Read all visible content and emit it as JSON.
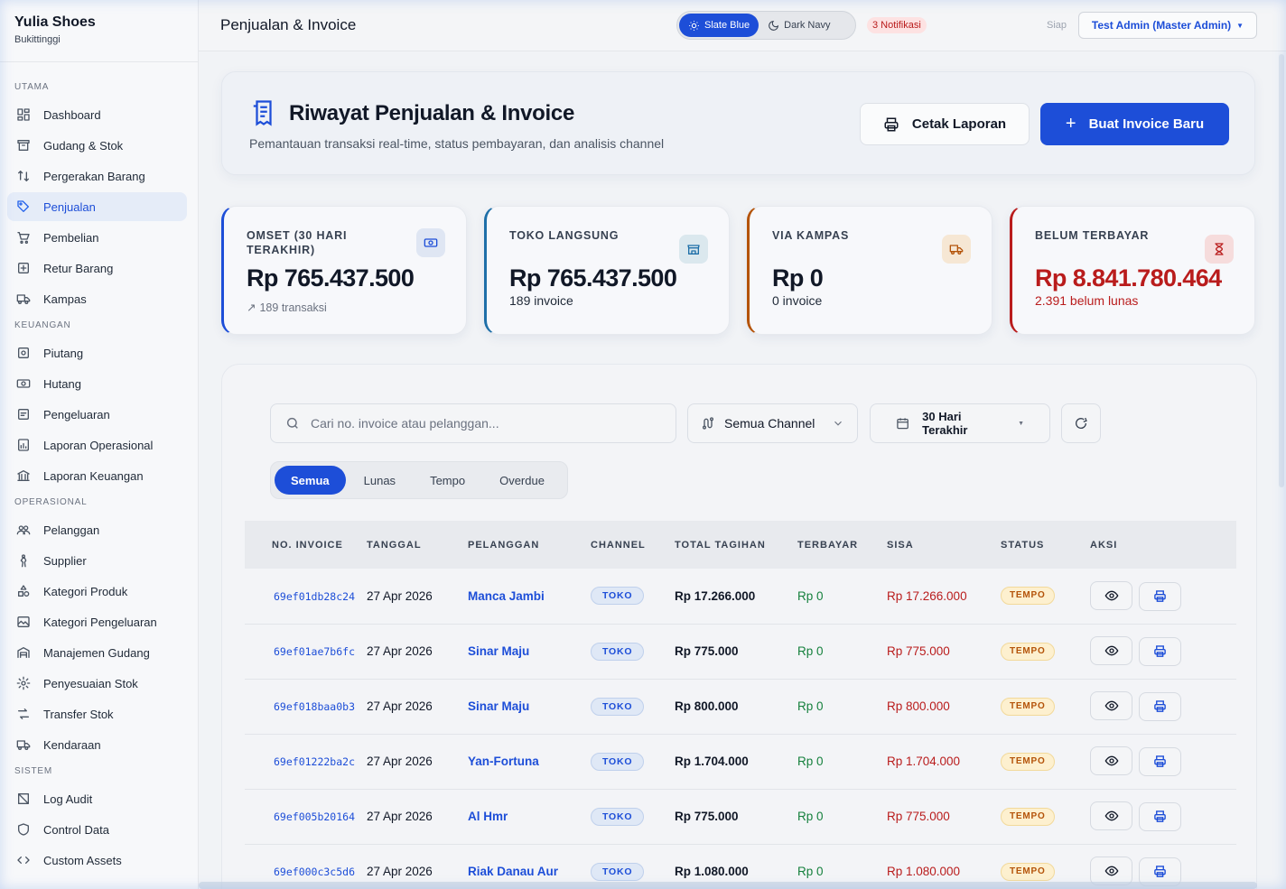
{
  "brand": {
    "name": "Yulia Shoes",
    "location": "Bukittinggi"
  },
  "sidebar": {
    "sections": [
      {
        "title": "UTAMA",
        "items": [
          {
            "label": "Dashboard",
            "icon": "dashboard-icon"
          },
          {
            "label": "Gudang & Stok",
            "icon": "archive-icon"
          },
          {
            "label": "Pergerakan Barang",
            "icon": "arrows-icon"
          },
          {
            "label": "Penjualan",
            "icon": "tag-icon",
            "active": true
          },
          {
            "label": "Pembelian",
            "icon": "cart-icon"
          },
          {
            "label": "Retur Barang",
            "icon": "return-icon"
          },
          {
            "label": "Kampas",
            "icon": "truck-icon"
          }
        ]
      },
      {
        "title": "KEUANGAN",
        "items": [
          {
            "label": "Piutang",
            "icon": "receivable-icon"
          },
          {
            "label": "Hutang",
            "icon": "money-icon"
          },
          {
            "label": "Pengeluaran",
            "icon": "expense-icon"
          },
          {
            "label": "Laporan Operasional",
            "icon": "report-icon"
          },
          {
            "label": "Laporan Keuangan",
            "icon": "bank-icon"
          }
        ]
      },
      {
        "title": "OPERASIONAL",
        "items": [
          {
            "label": "Pelanggan",
            "icon": "users-icon"
          },
          {
            "label": "Supplier",
            "icon": "person-icon"
          },
          {
            "label": "Kategori Produk",
            "icon": "shapes-icon"
          },
          {
            "label": "Kategori Pengeluaran",
            "icon": "image-icon"
          },
          {
            "label": "Manajemen Gudang",
            "icon": "warehouse-icon"
          },
          {
            "label": "Penyesuaian Stok",
            "icon": "gear-icon"
          },
          {
            "label": "Transfer Stok",
            "icon": "transfer-icon"
          },
          {
            "label": "Kendaraan",
            "icon": "truck-icon"
          }
        ]
      },
      {
        "title": "SISTEM",
        "items": [
          {
            "label": "Log Audit",
            "icon": "log-icon"
          },
          {
            "label": "Control Data",
            "icon": "shield-icon"
          },
          {
            "label": "Custom Assets",
            "icon": "code-icon"
          }
        ]
      }
    ]
  },
  "header": {
    "title": "Penjualan & Invoice",
    "theme_light": "Slate Blue",
    "theme_dark": "Dark Navy",
    "notifications": "3 Notifikasi",
    "status": "Siap",
    "user": "Test Admin (Master Admin)"
  },
  "hero": {
    "title": "Riwayat Penjualan & Invoice",
    "subtitle": "Pemantauan transaksi real-time, status pembayaran, dan analisis channel",
    "print_label": "Cetak Laporan",
    "new_label": "Buat Invoice Baru"
  },
  "stats": [
    {
      "label": "OMSET (30 HARI TERAKHIR)",
      "value": "Rp 765.437.500",
      "foot": "189 transaksi",
      "color": "#1d4ed8",
      "icon_bg": "#dfe6f3",
      "icon_color": "#1d4ed8",
      "value_color": "#111827",
      "foot_color": "#6b7280",
      "icon": "money-icon"
    },
    {
      "label": "TOKO LANGSUNG",
      "value": "Rp 765.437.500",
      "foot": "189 invoice",
      "color": "#1e6fa8",
      "icon_bg": "#dbe8ee",
      "icon_color": "#1e6fa8",
      "value_color": "#111827",
      "foot_color": "#1f2937",
      "icon": "store-icon"
    },
    {
      "label": "VIA KAMPAS",
      "value": "Rp 0",
      "foot": "0 invoice",
      "color": "#b45309",
      "icon_bg": "#f6e7d4",
      "icon_color": "#b45309",
      "value_color": "#111827",
      "foot_color": "#1f2937",
      "icon": "truck-icon"
    },
    {
      "label": "BELUM TERBAYAR",
      "value": "Rp 8.841.780.464",
      "foot": "2.391 belum lunas",
      "color": "#b91c1c",
      "icon_bg": "#f6dcdc",
      "icon_color": "#b91c1c",
      "value_color": "#b91c1c",
      "foot_color": "#b91c1c",
      "icon": "hourglass-icon"
    }
  ],
  "filters": {
    "search_placeholder": "Cari no. invoice atau pelanggan...",
    "channel": "Semua Channel",
    "date_range": "30 Hari Terakhir",
    "tabs": [
      "Semua",
      "Lunas",
      "Tempo",
      "Overdue"
    ]
  },
  "table": {
    "columns": [
      "NO. INVOICE",
      "TANGGAL",
      "PELANGGAN",
      "CHANNEL",
      "TOTAL TAGIHAN",
      "TERBAYAR",
      "SISA",
      "STATUS",
      "AKSI"
    ],
    "rows": [
      {
        "invoice": "69ef01db28c24",
        "date": "27 Apr 2026",
        "customer": "Manca Jambi",
        "channel": "TOKO",
        "total": "Rp 17.266.000",
        "paid": "Rp 0",
        "rest": "Rp 17.266.000",
        "status": "TEMPO"
      },
      {
        "invoice": "69ef01ae7b6fc",
        "date": "27 Apr 2026",
        "customer": "Sinar Maju",
        "channel": "TOKO",
        "total": "Rp 775.000",
        "paid": "Rp 0",
        "rest": "Rp 775.000",
        "status": "TEMPO"
      },
      {
        "invoice": "69ef018baa0b3",
        "date": "27 Apr 2026",
        "customer": "Sinar Maju",
        "channel": "TOKO",
        "total": "Rp 800.000",
        "paid": "Rp 0",
        "rest": "Rp 800.000",
        "status": "TEMPO"
      },
      {
        "invoice": "69ef01222ba2c",
        "date": "27 Apr 2026",
        "customer": "Yan-Fortuna",
        "channel": "TOKO",
        "total": "Rp 1.704.000",
        "paid": "Rp 0",
        "rest": "Rp 1.704.000",
        "status": "TEMPO"
      },
      {
        "invoice": "69ef005b20164",
        "date": "27 Apr 2026",
        "customer": "Al Hmr",
        "channel": "TOKO",
        "total": "Rp 775.000",
        "paid": "Rp 0",
        "rest": "Rp 775.000",
        "status": "TEMPO"
      },
      {
        "invoice": "69ef000c3c5d6",
        "date": "27 Apr 2026",
        "customer": "Riak Danau Aur",
        "channel": "TOKO",
        "total": "Rp 1.080.000",
        "paid": "Rp 0",
        "rest": "Rp 1.080.000",
        "status": "TEMPO"
      }
    ]
  }
}
